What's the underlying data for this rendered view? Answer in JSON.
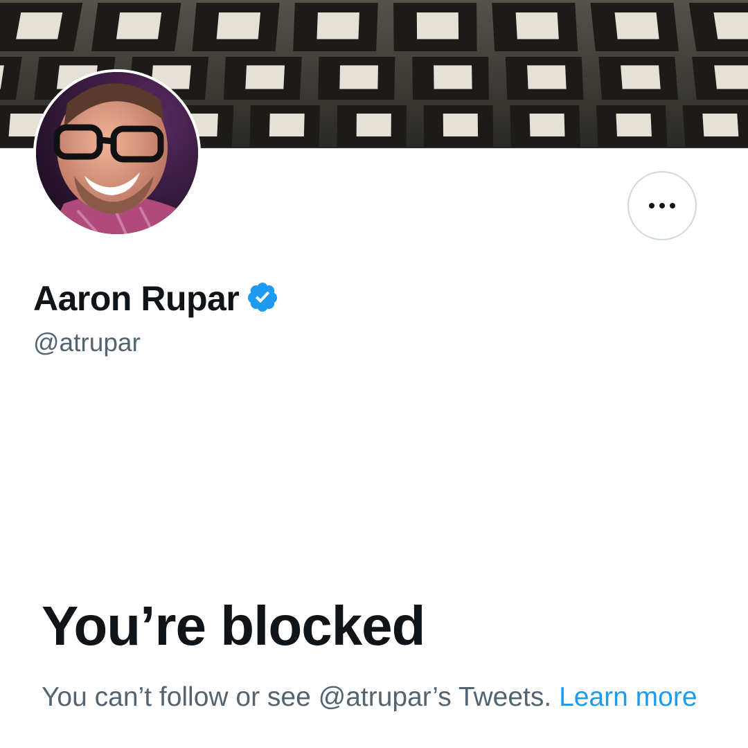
{
  "profile": {
    "display_name": "Aaron Rupar",
    "handle": "@atrupar",
    "verified": true,
    "avatar_icon": "profile-photo",
    "banner_icon": "coffered-vault-ceiling-photo"
  },
  "actions": {
    "more_icon": "more-horizontal-icon"
  },
  "blocked": {
    "title": "You’re blocked",
    "message": "You can’t follow or see @atrupar’s Tweets.",
    "learn_more": "Learn more"
  },
  "colors": {
    "verified_blue": "#1d9bf0",
    "link_blue": "#1d9bf0",
    "primary_text": "#0f1419",
    "secondary_text": "#536471",
    "border": "#cfd9de"
  }
}
